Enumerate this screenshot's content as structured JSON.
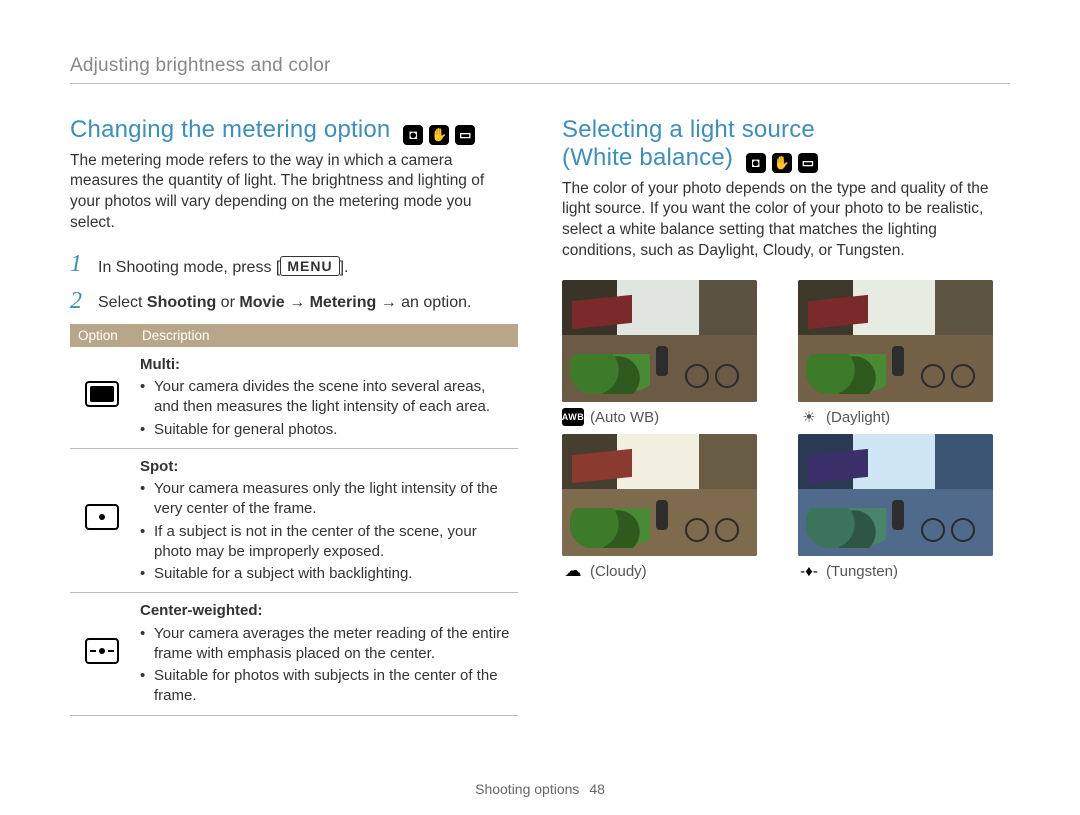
{
  "breadcrumb": "Adjusting brightness and color",
  "left": {
    "title": "Changing the metering option",
    "intro": "The metering mode refers to the way in which a camera measures the quantity of light. The brightness and lighting of your photos will vary depending on the metering mode you select.",
    "step1_pre": "In Shooting mode, press [",
    "step1_key": "MENU",
    "step1_post": "].",
    "step2_a": "Select ",
    "step2_b": "Shooting",
    "step2_c": " or ",
    "step2_d": "Movie",
    "step2_e": " → ",
    "step2_f": "Metering",
    "step2_g": " → an option.",
    "th_option": "Option",
    "th_desc": "Description",
    "rows": {
      "multi": {
        "name": "Multi:",
        "b1": "Your camera divides the scene into several areas, and then measures the light intensity of each area.",
        "b2": "Suitable for general photos."
      },
      "spot": {
        "name": "Spot:",
        "b1": "Your camera measures only the light intensity of the very center of the frame.",
        "b2": "If a subject is not in the center of the scene, your photo may be improperly exposed.",
        "b3": "Suitable for a subject with backlighting."
      },
      "cw": {
        "name": "Center-weighted:",
        "b1": "Your camera averages the meter reading of the entire frame with emphasis placed on the center.",
        "b2": "Suitable for photos with subjects in the center of the frame."
      }
    }
  },
  "right": {
    "title_l1": "Selecting a light source",
    "title_l2": "(White balance)",
    "intro": "The color of your photo depends on the type and quality of the light source. If you want the color of your photo to be realistic, select a white balance setting that matches the lighting conditions, such as Daylight, Cloudy, or Tungsten.",
    "wb": {
      "auto": "(Auto WB)",
      "day": "(Daylight)",
      "cloudy": "(Cloudy)",
      "tung": "(Tungsten)"
    }
  },
  "footer": {
    "section": "Shooting options",
    "page": "48"
  }
}
